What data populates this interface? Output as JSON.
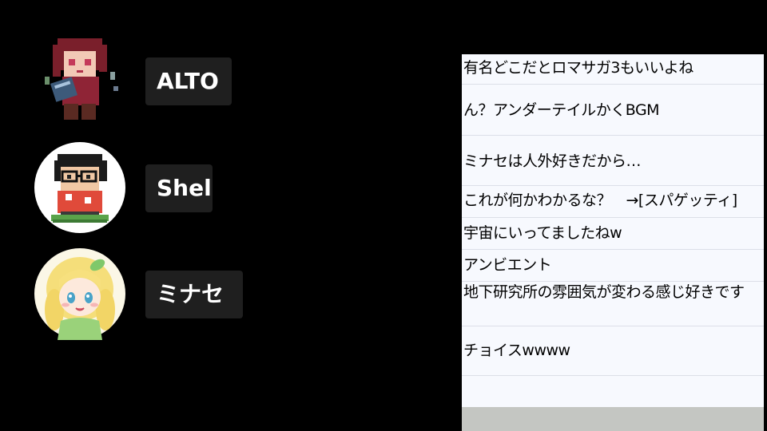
{
  "speakers": [
    {
      "name": "ALTO",
      "icon": "pixel-avatar-girl-icon"
    },
    {
      "name": "Shel",
      "icon": "pixel-avatar-glasses-boy-icon"
    },
    {
      "name": "ミナセ",
      "icon": "anime-avatar-blonde-elf-icon"
    }
  ],
  "chat": {
    "messages": [
      "有名どこだとロマサガ3もいいよね",
      "ん？アンダーテイルかくBGM",
      "ミナセは人外好きだから…",
      "これが何かわかるな？　→[スパゲッティ]",
      "宇宙にいってましたねw",
      "アンビエント",
      "地下研究所の雰囲気が変わる感じ好きです",
      "チョイスwwww"
    ]
  },
  "colors": {
    "background": "#000000",
    "name_tag_bg": "#1f1f1f",
    "chat_bg": "#f7f9fe",
    "chat_footer": "#c4c6c2"
  }
}
